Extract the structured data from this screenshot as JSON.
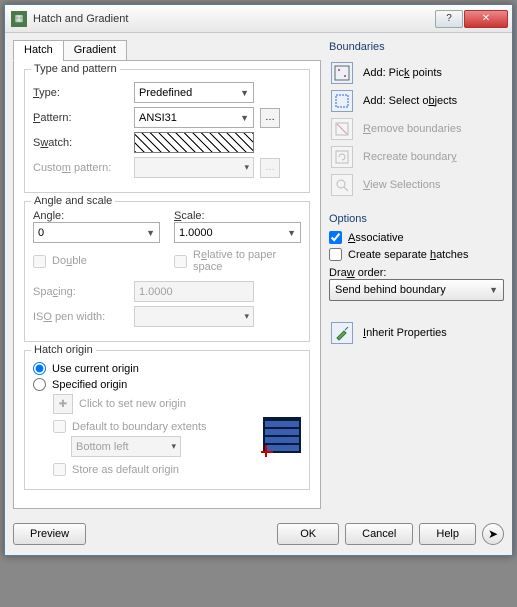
{
  "window": {
    "title": "Hatch and Gradient"
  },
  "tabs": {
    "hatch": "Hatch",
    "gradient": "Gradient"
  },
  "type_pattern": {
    "title": "Type and pattern",
    "type_label": "Type:",
    "type_value": "Predefined",
    "pattern_label": "Pattern:",
    "pattern_value": "ANSI31",
    "swatch_label": "Swatch:",
    "custom_label": "Custom pattern:",
    "custom_value": ""
  },
  "angle_scale": {
    "title": "Angle and scale",
    "angle_label": "Angle:",
    "angle_value": "0",
    "scale_label": "Scale:",
    "scale_value": "1.0000",
    "double_label": "Double",
    "relative_label": "Relative to paper space",
    "spacing_label": "Spacing:",
    "spacing_value": "1.0000",
    "iso_label": "ISO pen width:",
    "iso_value": ""
  },
  "origin": {
    "title": "Hatch origin",
    "use_current": "Use current origin",
    "specified": "Specified origin",
    "click_new": "Click to set new origin",
    "default_ext": "Default to boundary extents",
    "corner_value": "Bottom left",
    "store_default": "Store as default origin"
  },
  "boundaries": {
    "title": "Boundaries",
    "pick_points": "Add: Pick points",
    "select_objects": "Add: Select objects",
    "remove": "Remove boundaries",
    "recreate": "Recreate boundary",
    "view_sel": "View Selections"
  },
  "options": {
    "title": "Options",
    "associative": "Associative",
    "separate": "Create separate hatches",
    "draw_order_label": "Draw order:",
    "draw_order_value": "Send behind boundary"
  },
  "inherit": {
    "label": "Inherit Properties"
  },
  "buttons": {
    "preview": "Preview",
    "ok": "OK",
    "cancel": "Cancel",
    "help": "Help"
  }
}
